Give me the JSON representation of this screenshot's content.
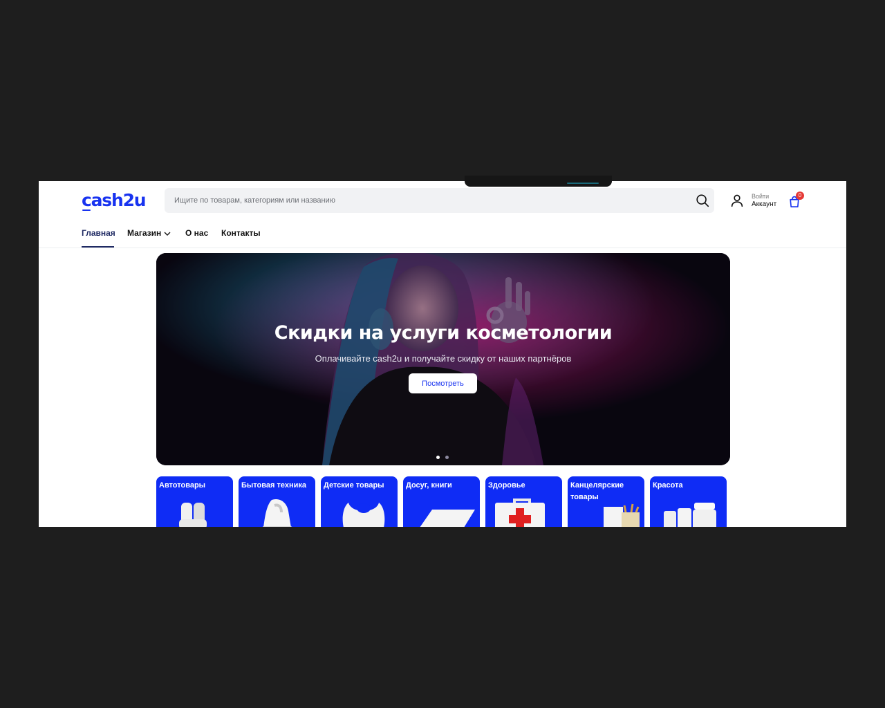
{
  "header": {
    "logo": "cash2u",
    "search_placeholder": "Ищите по товарам, категориям или названию",
    "account_small": "Войти",
    "account_big": "Аккаунт",
    "cart_count": "0"
  },
  "nav": [
    {
      "label": "Главная",
      "active": true
    },
    {
      "label": "Магазин",
      "dropdown": true
    },
    {
      "label": "О нас"
    },
    {
      "label": "Контакты"
    }
  ],
  "hero": {
    "title": "Скидки на услуги косметологии",
    "subtitle": "Оплачивайте cash2u и получайте скидку от наших партнёров",
    "button": "Посмотреть",
    "slides_total": 2,
    "slide_active": 1
  },
  "categories": [
    {
      "label": "Автотовары",
      "icon": "car-seats-icon"
    },
    {
      "label": "Бытовая техника",
      "icon": "iron-icon"
    },
    {
      "label": "Детские товары",
      "icon": "baby-bib-icon"
    },
    {
      "label": "Досуг, книги",
      "icon": "book-icon"
    },
    {
      "label": "Здоровье",
      "icon": "first-aid-kit-icon"
    },
    {
      "label": "Канцелярские товары",
      "icon": "stationery-icon"
    },
    {
      "label": "Красота",
      "icon": "cosmetics-jars-icon"
    }
  ],
  "colors": {
    "brand": "#1833f0",
    "category_bg": "#0f2cf5",
    "nav_active": "#1f2a63",
    "badge": "#e53935",
    "backdrop": "#1e1e1e"
  }
}
